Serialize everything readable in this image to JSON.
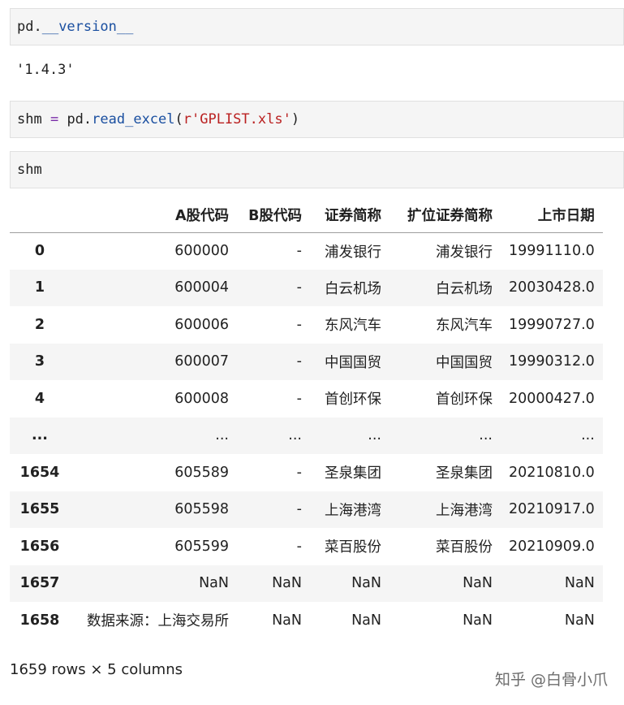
{
  "cells": [
    {
      "input_parts": {
        "a": "pd.",
        "b": "__version__"
      }
    },
    {
      "output": "'1.4.3'"
    },
    {
      "input_parts": {
        "a": "shm ",
        "b": "=",
        "c": " pd.",
        "d": "read_excel",
        "e": "(",
        "f": "r'GPLIST.xls'",
        "g": ")"
      }
    },
    {
      "input_parts": {
        "a": "shm"
      }
    }
  ],
  "table": {
    "columns": [
      "",
      "A股代码",
      "B股代码",
      "证券简称",
      "扩位证券简称",
      "上市日期"
    ],
    "rows": [
      [
        "0",
        "600000",
        "-",
        "浦发银行",
        "浦发银行",
        "19991110.0"
      ],
      [
        "1",
        "600004",
        "-",
        "白云机场",
        "白云机场",
        "20030428.0"
      ],
      [
        "2",
        "600006",
        "-",
        "东风汽车",
        "东风汽车",
        "19990727.0"
      ],
      [
        "3",
        "600007",
        "-",
        "中国国贸",
        "中国国贸",
        "19990312.0"
      ],
      [
        "4",
        "600008",
        "-",
        "首创环保",
        "首创环保",
        "20000427.0"
      ],
      [
        "...",
        "...",
        "...",
        "...",
        "...",
        "..."
      ],
      [
        "1654",
        "605589",
        "-",
        "圣泉集团",
        "圣泉集团",
        "20210810.0"
      ],
      [
        "1655",
        "605598",
        "-",
        "上海港湾",
        "上海港湾",
        "20210917.0"
      ],
      [
        "1656",
        "605599",
        "-",
        "菜百股份",
        "菜百股份",
        "20210909.0"
      ],
      [
        "1657",
        "NaN",
        "NaN",
        "NaN",
        "NaN",
        "NaN"
      ],
      [
        "1658",
        "数据来源：上海交易所",
        "NaN",
        "NaN",
        "NaN",
        "NaN"
      ]
    ]
  },
  "summary": "1659 rows × 5 columns",
  "watermark": "知乎 @白骨小爪"
}
